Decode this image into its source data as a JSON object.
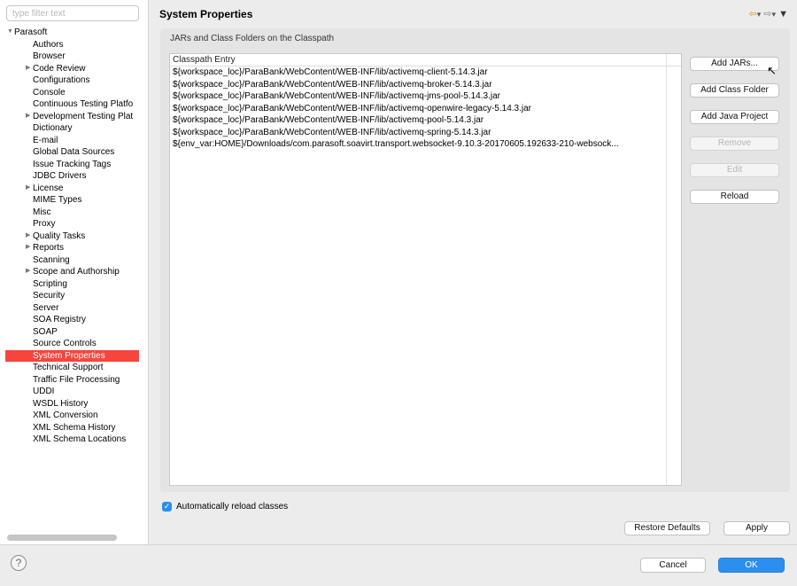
{
  "filter": {
    "placeholder": "type filter text"
  },
  "tree": {
    "root": "Parasoft",
    "items": [
      {
        "label": "Authors",
        "expandable": false
      },
      {
        "label": "Browser",
        "expandable": false
      },
      {
        "label": "Code Review",
        "expandable": true
      },
      {
        "label": "Configurations",
        "expandable": false
      },
      {
        "label": "Console",
        "expandable": false
      },
      {
        "label": "Continuous Testing Platfo",
        "expandable": false
      },
      {
        "label": "Development Testing Plat",
        "expandable": true
      },
      {
        "label": "Dictionary",
        "expandable": false
      },
      {
        "label": "E-mail",
        "expandable": false
      },
      {
        "label": "Global Data Sources",
        "expandable": false
      },
      {
        "label": "Issue Tracking Tags",
        "expandable": false
      },
      {
        "label": "JDBC Drivers",
        "expandable": false
      },
      {
        "label": "License",
        "expandable": true
      },
      {
        "label": "MIME Types",
        "expandable": false
      },
      {
        "label": "Misc",
        "expandable": false
      },
      {
        "label": "Proxy",
        "expandable": false
      },
      {
        "label": "Quality Tasks",
        "expandable": true
      },
      {
        "label": "Reports",
        "expandable": true
      },
      {
        "label": "Scanning",
        "expandable": false
      },
      {
        "label": "Scope and Authorship",
        "expandable": true
      },
      {
        "label": "Scripting",
        "expandable": false
      },
      {
        "label": "Security",
        "expandable": false
      },
      {
        "label": "Server",
        "expandable": false
      },
      {
        "label": "SOA Registry",
        "expandable": false
      },
      {
        "label": "SOAP",
        "expandable": false
      },
      {
        "label": "Source Controls",
        "expandable": false
      },
      {
        "label": "System Properties",
        "expandable": false,
        "selected": true
      },
      {
        "label": "Technical Support",
        "expandable": false
      },
      {
        "label": "Traffic File Processing",
        "expandable": false
      },
      {
        "label": "UDDI",
        "expandable": false
      },
      {
        "label": "WSDL History",
        "expandable": false
      },
      {
        "label": "XML Conversion",
        "expandable": false
      },
      {
        "label": "XML Schema History",
        "expandable": false
      },
      {
        "label": "XML Schema Locations",
        "expandable": false
      }
    ]
  },
  "page": {
    "title": "System Properties"
  },
  "group": {
    "label": "JARs and Class Folders on the Classpath"
  },
  "table": {
    "header": "Classpath Entry",
    "rows": [
      "${workspace_loc}/ParaBank/WebContent/WEB-INF/lib/activemq-client-5.14.3.jar",
      "${workspace_loc}/ParaBank/WebContent/WEB-INF/lib/activemq-broker-5.14.3.jar",
      "${workspace_loc}/ParaBank/WebContent/WEB-INF/lib/activemq-jms-pool-5.14.3.jar",
      "${workspace_loc}/ParaBank/WebContent/WEB-INF/lib/activemq-openwire-legacy-5.14.3.jar",
      "${workspace_loc}/ParaBank/WebContent/WEB-INF/lib/activemq-pool-5.14.3.jar",
      "${workspace_loc}/ParaBank/WebContent/WEB-INF/lib/activemq-spring-5.14.3.jar",
      "${env_var:HOME}/Downloads/com.parasoft.soavirt.transport.websocket-9.10.3-20170605.192633-210-websock..."
    ]
  },
  "buttons": {
    "add_jars": "Add JARs...",
    "add_class_folder": "Add Class Folder",
    "add_java_project": "Add Java Project",
    "remove": "Remove",
    "edit": "Edit",
    "reload": "Reload",
    "restore_defaults": "Restore Defaults",
    "apply": "Apply",
    "cancel": "Cancel",
    "ok": "OK"
  },
  "checkbox": {
    "label": "Automatically reload classes",
    "checked": true
  },
  "help": {
    "glyph": "?"
  },
  "colors": {
    "selection": "#f6453d",
    "primary": "#2c8fef"
  }
}
